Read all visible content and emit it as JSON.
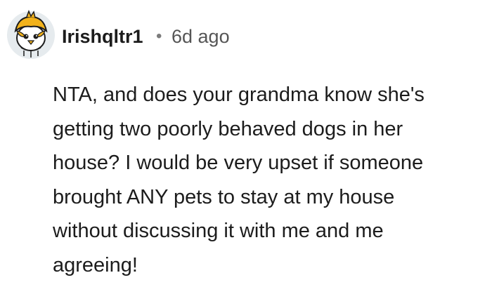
{
  "comment": {
    "author": "Irishqltr1",
    "separator": "•",
    "timestamp": "6d ago",
    "avatar_icon": "snoo-bird-avatar-icon",
    "body_lines": [
      "NTA, and does your grandma know she's",
      "getting two poorly behaved dogs in her",
      "house? I would be very upset if someone",
      "brought ANY pets to stay at my house",
      "without discussing it with me and me",
      "agreeing!"
    ]
  },
  "colors": {
    "text": "#1c1c1c",
    "meta": "#7c7c7c",
    "avatar_bg": "#e6ebee",
    "avatar_accent": "#f2b21b"
  }
}
